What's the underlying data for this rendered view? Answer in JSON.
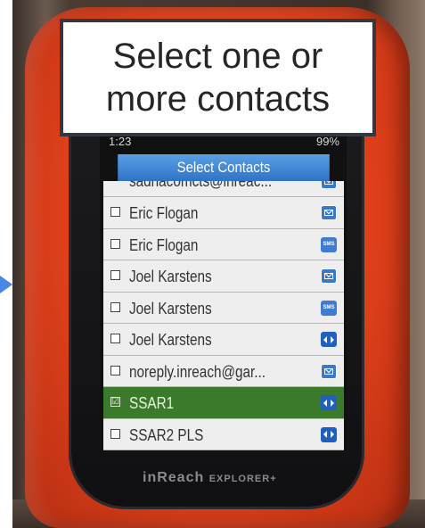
{
  "callout": {
    "line1": "Select one or",
    "line2": "more contacts"
  },
  "status": {
    "left": "1:23",
    "right": "99%"
  },
  "screen": {
    "title": "Select Contacts",
    "partial_row_label": "sadhacomcts@inreac...",
    "rows": [
      {
        "label": "Eric Flogan",
        "checked": false,
        "icon": "email-icon"
      },
      {
        "label": "Eric Flogan",
        "checked": false,
        "icon": "sms-icon"
      },
      {
        "label": "Joel Karstens",
        "checked": false,
        "icon": "email-icon"
      },
      {
        "label": "Joel Karstens",
        "checked": false,
        "icon": "sms-icon"
      },
      {
        "label": "Joel Karstens",
        "checked": false,
        "icon": "inreach-icon"
      },
      {
        "label": "noreply.inreach@gar...",
        "checked": false,
        "icon": "email-icon"
      },
      {
        "label": "SSAR1",
        "checked": true,
        "icon": "inreach-icon"
      },
      {
        "label": "SSAR2 PLS",
        "checked": false,
        "icon": "inreach-icon"
      }
    ],
    "checkmark": "☑",
    "sms_text": "SMS"
  },
  "device": {
    "brand": "inReach",
    "model": "EXPLORER+"
  },
  "colors": {
    "device_orange": "#e0401b",
    "title_blue": "#2f73c5",
    "selected_green": "#3c7a2b",
    "arrow_blue": "#4a86e8"
  }
}
